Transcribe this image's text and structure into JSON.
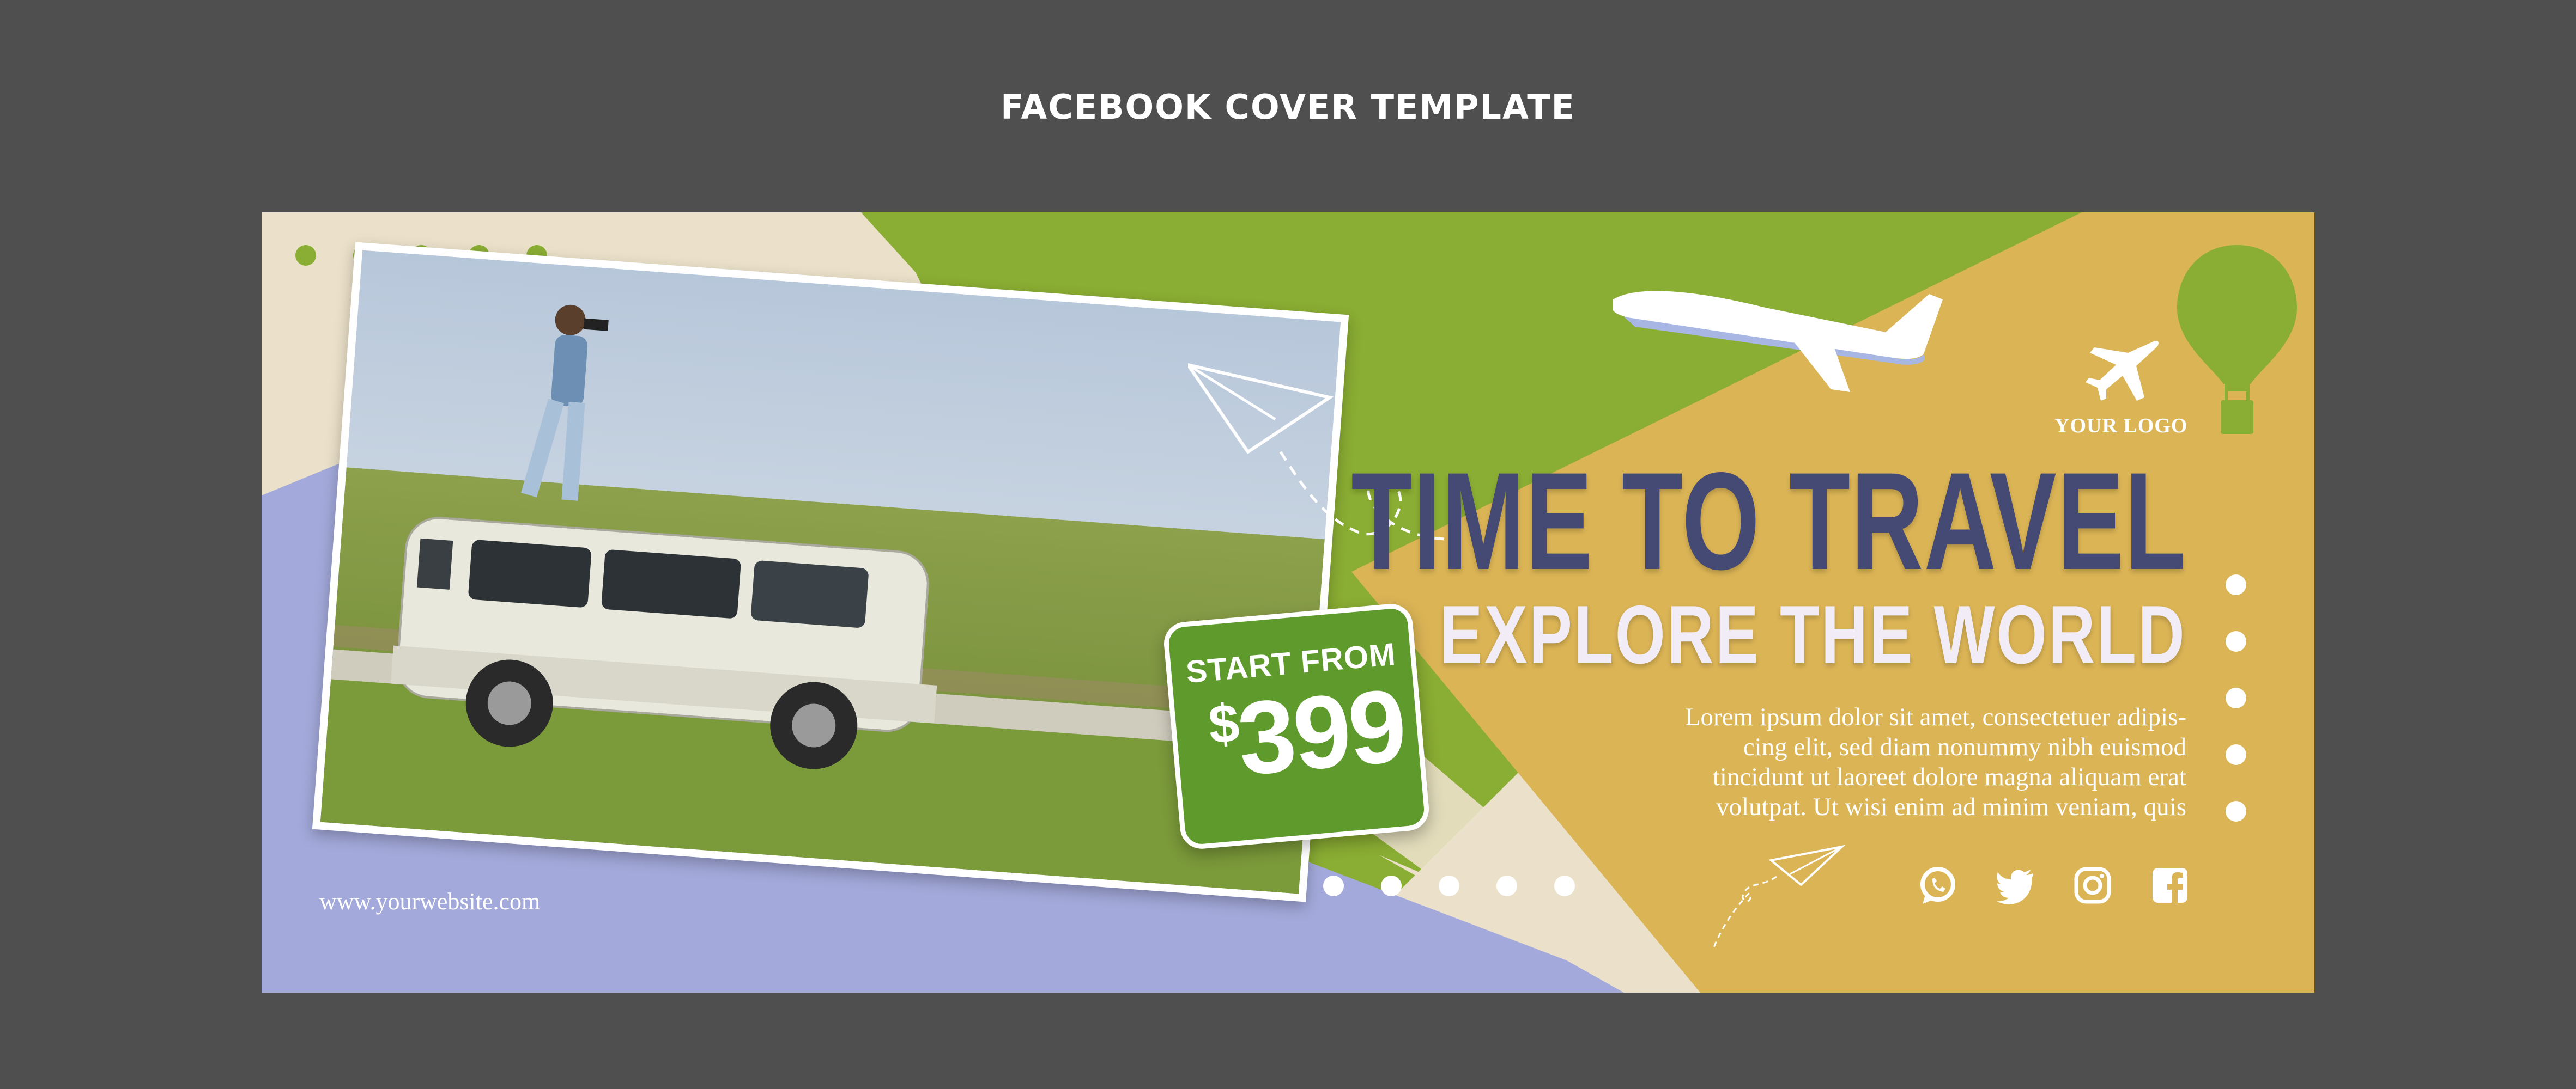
{
  "page_title": "FACEBOOK COVER TEMPLATE",
  "cover": {
    "headline": "TIME TO TRAVEL",
    "subheadline": "EXPLORE THE WORLD",
    "body_lines": [
      "Lorem ipsum dolor sit amet, consectetuer adipis-",
      "cing elit, sed diam nonummy nibh euismod",
      "tincidunt ut laoreet dolore magna aliquam erat",
      "volutpat. Ut wisi enim ad minim veniam, quis"
    ],
    "price_label": "START FROM",
    "price_currency": "$",
    "price_amount": "399",
    "logo_text": "YOUR LOGO",
    "website": "www.yourwebsite.com",
    "social_icons": [
      "whatsapp-icon",
      "twitter-icon",
      "instagram-icon",
      "facebook-icon"
    ]
  },
  "colors": {
    "background": "#4f4f4f",
    "beige": "#ebe1ca",
    "green": "#8aad33",
    "mustard": "#dbb455",
    "lavender": "#a3a9da",
    "navy_text": "#454a75",
    "badge_green": "#5f9a2c"
  }
}
